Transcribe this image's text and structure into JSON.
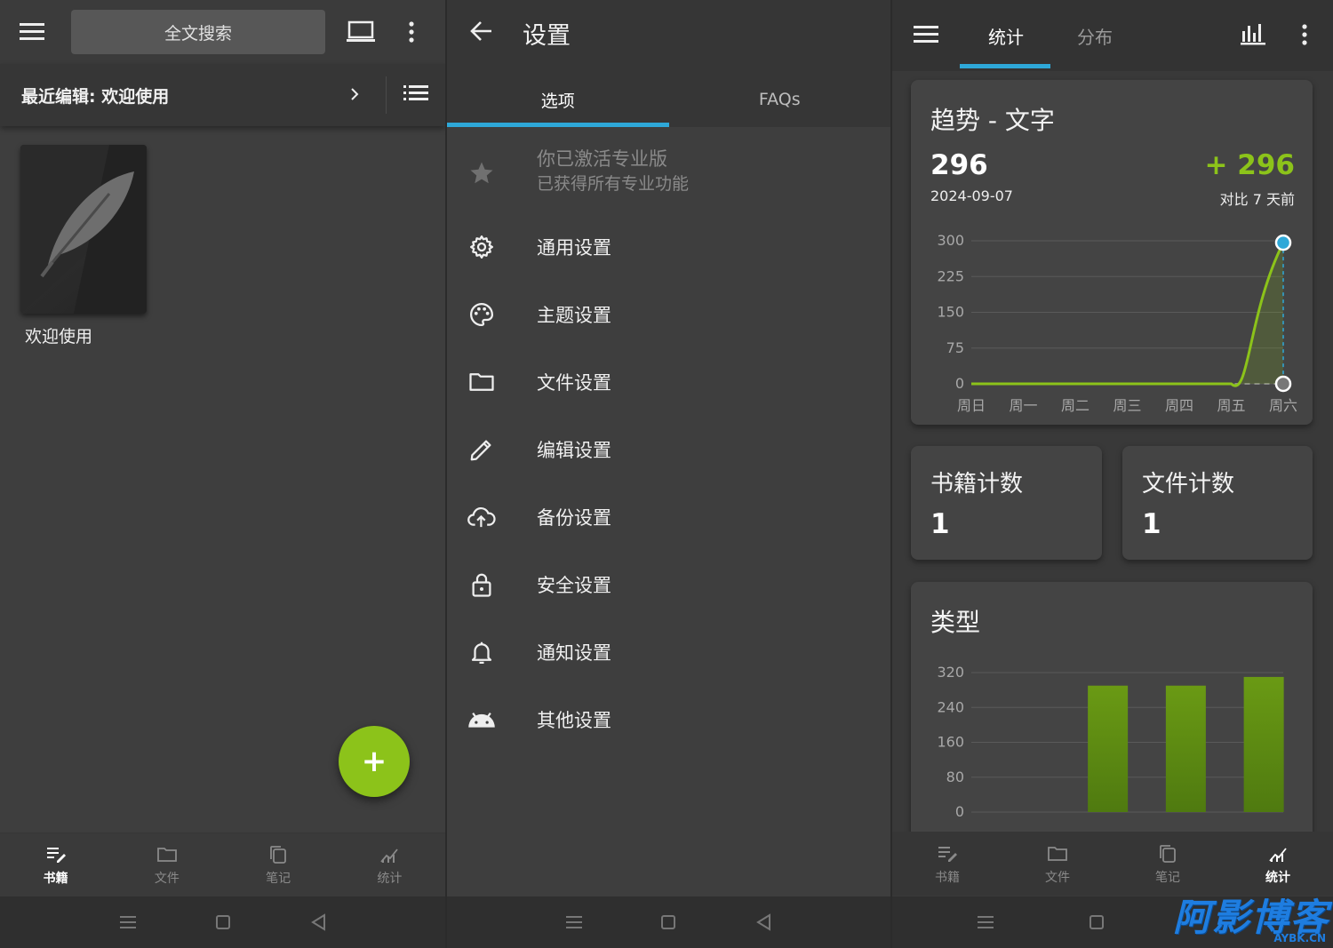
{
  "left": {
    "search_label": "全文搜索",
    "recent_label": "最近编辑: 欢迎使用",
    "book_title": "欢迎使用",
    "fab_label": "+",
    "bottom_nav": [
      {
        "label": "书籍",
        "icon": "book-edit-icon",
        "active": true
      },
      {
        "label": "文件",
        "icon": "folder-icon",
        "active": false
      },
      {
        "label": "笔记",
        "icon": "notes-icon",
        "active": false
      },
      {
        "label": "统计",
        "icon": "stats-icon",
        "active": false
      }
    ]
  },
  "settings": {
    "title": "设置",
    "tabs": [
      {
        "label": "选项",
        "active": true
      },
      {
        "label": "FAQs",
        "active": false
      }
    ],
    "pro_title": "你已激活专业版",
    "pro_sub": "已获得所有专业功能",
    "items": [
      {
        "label": "通用设置",
        "icon": "gear-icon"
      },
      {
        "label": "主题设置",
        "icon": "palette-icon"
      },
      {
        "label": "文件设置",
        "icon": "folder-icon"
      },
      {
        "label": "编辑设置",
        "icon": "pencil-icon"
      },
      {
        "label": "备份设置",
        "icon": "cloud-upload-icon"
      },
      {
        "label": "安全设置",
        "icon": "lock-icon"
      },
      {
        "label": "通知设置",
        "icon": "bell-icon"
      },
      {
        "label": "其他设置",
        "icon": "android-icon"
      }
    ]
  },
  "stats": {
    "tabs": [
      {
        "label": "统计",
        "active": true
      },
      {
        "label": "分布",
        "active": false
      }
    ],
    "trend_title": "趋势 - 文字",
    "trend_value": "296",
    "trend_date": "2024-09-07",
    "trend_delta": "+ 296",
    "trend_compare": "对比 7 天前",
    "book_count_label": "书籍计数",
    "book_count": "1",
    "file_count_label": "文件计数",
    "file_count": "1",
    "type_title": "类型",
    "bottom_nav": [
      {
        "label": "书籍",
        "active": false
      },
      {
        "label": "文件",
        "active": false
      },
      {
        "label": "笔记",
        "active": false
      },
      {
        "label": "统计",
        "active": true
      }
    ]
  },
  "colors": {
    "accent_green": "#8cc31a",
    "tab_indicator": "#2ea8d8"
  },
  "watermark_text": "阿影博客",
  "watermark_sub": "AYBK.CN",
  "chart_data": [
    {
      "type": "line",
      "title": "趋势 - 文字",
      "x": [
        "周日",
        "周一",
        "周二",
        "周三",
        "周四",
        "周五",
        "周六"
      ],
      "series": [
        {
          "values": [
            0,
            0,
            0,
            0,
            0,
            0,
            296
          ]
        }
      ],
      "yticks": [
        "300",
        "225",
        "150",
        "75",
        "0"
      ],
      "ylim": [
        0,
        300
      ],
      "grid": true
    },
    {
      "type": "bar",
      "title": "类型",
      "categories": [
        "",
        "",
        "",
        ""
      ],
      "values": [
        0,
        290,
        290,
        310
      ],
      "yticks": [
        "320",
        "240",
        "160",
        "80",
        "0"
      ],
      "ylim": [
        0,
        320
      ],
      "grid": true
    }
  ]
}
